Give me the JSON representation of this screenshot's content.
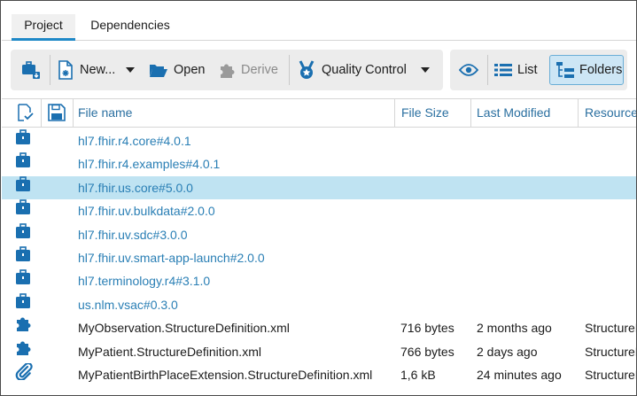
{
  "tabs": [
    {
      "label": "Project",
      "active": true
    },
    {
      "label": "Dependencies",
      "active": false
    }
  ],
  "toolbar": {
    "new_label": "New...",
    "open_label": "Open",
    "derive_label": "Derive",
    "quality_label": "Quality Control",
    "list_label": "List",
    "folders_label": "Folders"
  },
  "columns": {
    "name": "File name",
    "size": "File Size",
    "modified": "Last Modified",
    "resource": "Resource"
  },
  "colors": {
    "accent": "#1e88c7",
    "link": "#2a7fb5",
    "selection": "#bfe3f2",
    "icon_blue": "#1a6fb0"
  },
  "rows": [
    {
      "icon": "package-icon",
      "name": "hl7.fhir.r4.core#4.0.1",
      "size": "",
      "modified": "",
      "resource": "",
      "link": true
    },
    {
      "icon": "package-icon",
      "name": "hl7.fhir.r4.examples#4.0.1",
      "size": "",
      "modified": "",
      "resource": "",
      "link": true
    },
    {
      "icon": "package-icon",
      "name": "hl7.fhir.us.core#5.0.0",
      "size": "",
      "modified": "",
      "resource": "",
      "link": true,
      "selected": true
    },
    {
      "icon": "package-icon",
      "name": "hl7.fhir.uv.bulkdata#2.0.0",
      "size": "",
      "modified": "",
      "resource": "",
      "link": true
    },
    {
      "icon": "package-icon",
      "name": "hl7.fhir.uv.sdc#3.0.0",
      "size": "",
      "modified": "",
      "resource": "",
      "link": true
    },
    {
      "icon": "package-icon",
      "name": "hl7.fhir.uv.smart-app-launch#2.0.0",
      "size": "",
      "modified": "",
      "resource": "",
      "link": true
    },
    {
      "icon": "package-icon",
      "name": "hl7.terminology.r4#3.1.0",
      "size": "",
      "modified": "",
      "resource": "",
      "link": true
    },
    {
      "icon": "package-icon",
      "name": "us.nlm.vsac#0.3.0",
      "size": "",
      "modified": "",
      "resource": "",
      "link": true
    },
    {
      "icon": "puzzle-icon",
      "name": "MyObservation.StructureDefinition.xml",
      "size": "716 bytes",
      "modified": "2 months ago",
      "resource": "StructureDefinition",
      "link": false
    },
    {
      "icon": "puzzle-icon",
      "name": "MyPatient.StructureDefinition.xml",
      "size": "766 bytes",
      "modified": "2 days ago",
      "resource": "StructureDefinition",
      "link": false
    },
    {
      "icon": "paperclip-icon",
      "name": "MyPatientBirthPlaceExtension.StructureDefinition.xml",
      "size": "1,6 kB",
      "modified": "24 minutes ago",
      "resource": "StructureDefinition",
      "link": false
    }
  ]
}
